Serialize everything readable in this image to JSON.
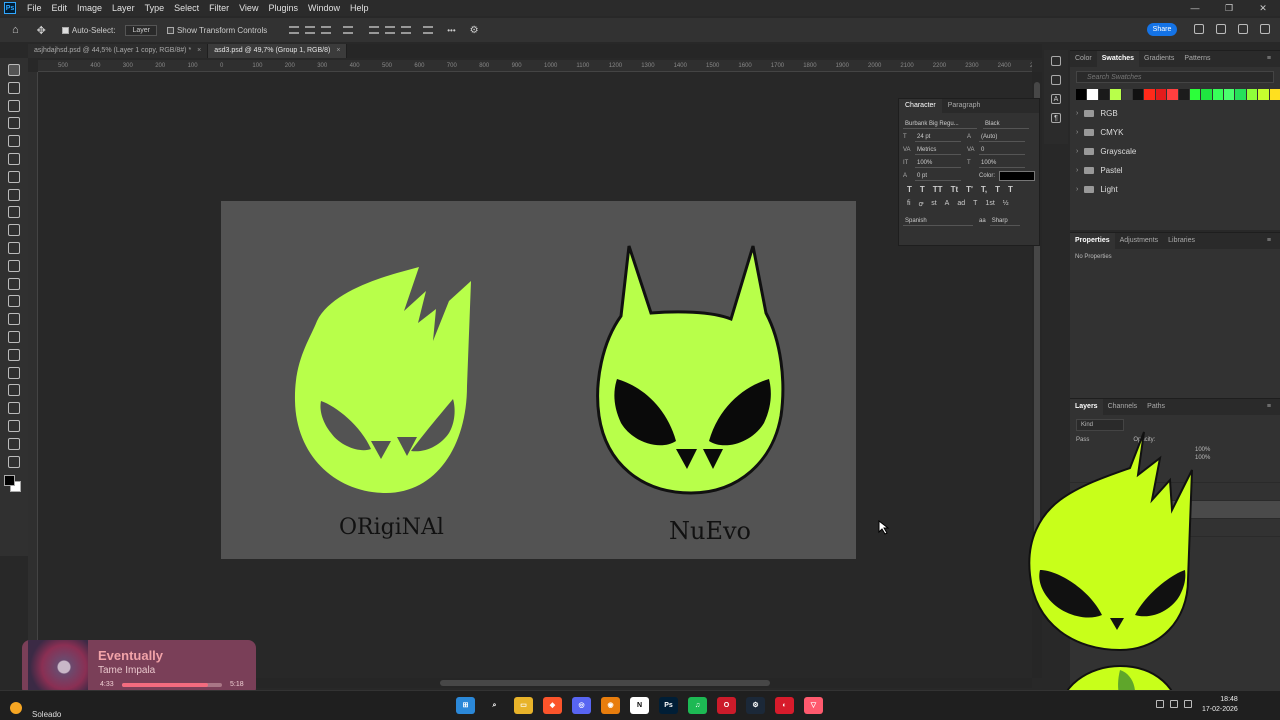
{
  "app": {
    "logo": "Ps"
  },
  "menu": [
    "File",
    "Edit",
    "Image",
    "Layer",
    "Type",
    "Select",
    "Filter",
    "View",
    "Plugins",
    "Window",
    "Help"
  ],
  "window_controls": {
    "minimize": "—",
    "restore": "❐",
    "close": "✕"
  },
  "options": {
    "auto_select_label": "Auto-Select:",
    "auto_select_checked": true,
    "target_value": "Layer",
    "transform_label": "Show Transform Controls",
    "more": "•••",
    "share_label": "Share"
  },
  "tabs": [
    {
      "label": "asjhdajhsd.psd @ 44,5% (Layer 1 copy, RGB/8#) *",
      "active": false
    },
    {
      "label": "asd3.psd @ 49,7% (Group 1, RGB/8)",
      "active": true
    }
  ],
  "ruler_marks": [
    "500",
    "400",
    "300",
    "200",
    "100",
    "0",
    "100",
    "200",
    "300",
    "400",
    "500",
    "600",
    "700",
    "800",
    "900",
    "1000",
    "1100",
    "1200",
    "1300",
    "1400",
    "1500",
    "1600",
    "1700",
    "1800",
    "1900",
    "2000",
    "2100",
    "2200",
    "2300",
    "2400",
    "2450"
  ],
  "artboard": {
    "label_left": "ORigiNAl",
    "label_right": "NuEvo",
    "bg_color": "#535353",
    "mascot_color": "#b8ff4a"
  },
  "character_panel": {
    "tabs": [
      "Character",
      "Paragraph"
    ],
    "font_family": "Burbank Big Regu...",
    "font_style": "Black",
    "font_size": "24 pt",
    "leading": "(Auto)",
    "kerning": "Metrics",
    "tracking": "0",
    "vscale": "100%",
    "hscale": "100%",
    "baseline": "0 pt",
    "color_label": "Color:",
    "language": "Spanish",
    "aa_label": "aa",
    "antialias": "Sharp",
    "style_buttons": [
      "T",
      "T",
      "TT",
      "Tt",
      "T'",
      "T,",
      "T",
      "T"
    ],
    "opentype_buttons": [
      "fi",
      "ꝍ",
      "st",
      "A",
      "ad",
      "T",
      "1st",
      "½"
    ]
  },
  "swatches_panel": {
    "tabs": [
      "Color",
      "Swatches",
      "Gradients",
      "Patterns"
    ],
    "active": "Swatches",
    "search_placeholder": "Search Swatches",
    "colors": [
      "#000000",
      "#ffffff",
      "#1a1a1a",
      "#b8ff4a",
      "#3c3c3c",
      "#111111",
      "#ff2a1a",
      "#e31b1b",
      "#ff3f3f",
      "#1c1c1c",
      "#2cff3a",
      "#1fe640",
      "#38ff59",
      "#4aff6e",
      "#26e05a",
      "#8fff3a",
      "#c6ff2e",
      "#ffe01f"
    ],
    "folders": [
      "RGB",
      "CMYK",
      "Grayscale",
      "Pastel",
      "Light"
    ]
  },
  "properties_panel": {
    "tabs": [
      "Properties",
      "Adjustments",
      "Libraries"
    ],
    "empty_text": "No Properties"
  },
  "layers_panel": {
    "tabs": [
      "Layers",
      "Channels",
      "Paths"
    ],
    "kind_label": "Kind",
    "blend_mode": "Pass",
    "opacity_label": "Opacity:",
    "opacity": "100%",
    "fill": "100%"
  },
  "music": {
    "title": "Eventually",
    "artist": "Tame Impala",
    "current": "4:33",
    "total": "5:18",
    "progress": 0.857
  },
  "taskbar": {
    "weather_text": "Soleado",
    "time": "18:48",
    "date": "17-02-2026",
    "apps": [
      {
        "name": "start-icon",
        "color": "#2b88d8",
        "glyph": "⊞"
      },
      {
        "name": "search-icon",
        "color": "transparent",
        "glyph": "⌕"
      },
      {
        "name": "file-explorer-icon",
        "color": "#e8b32a",
        "glyph": "▭"
      },
      {
        "name": "brave-icon",
        "color": "#fb542b",
        "glyph": "◆"
      },
      {
        "name": "discord-icon",
        "color": "#5865f2",
        "glyph": "◎"
      },
      {
        "name": "blender-icon",
        "color": "#e87d0d",
        "glyph": "◉"
      },
      {
        "name": "notion-icon",
        "color": "#ffffff",
        "glyph": "N"
      },
      {
        "name": "photoshop-icon",
        "color": "#001e36",
        "glyph": "Ps"
      },
      {
        "name": "spotify-icon",
        "color": "#1db954",
        "glyph": "♫"
      },
      {
        "name": "opera-icon",
        "color": "#cc1b2a",
        "glyph": "O"
      },
      {
        "name": "steam-icon",
        "color": "#1b2838",
        "glyph": "⚙"
      },
      {
        "name": "app-red-icon",
        "color": "#d71b2b",
        "glyph": "◐"
      },
      {
        "name": "app-tri-icon",
        "color": "#ff5a6e",
        "glyph": "▽"
      }
    ]
  }
}
